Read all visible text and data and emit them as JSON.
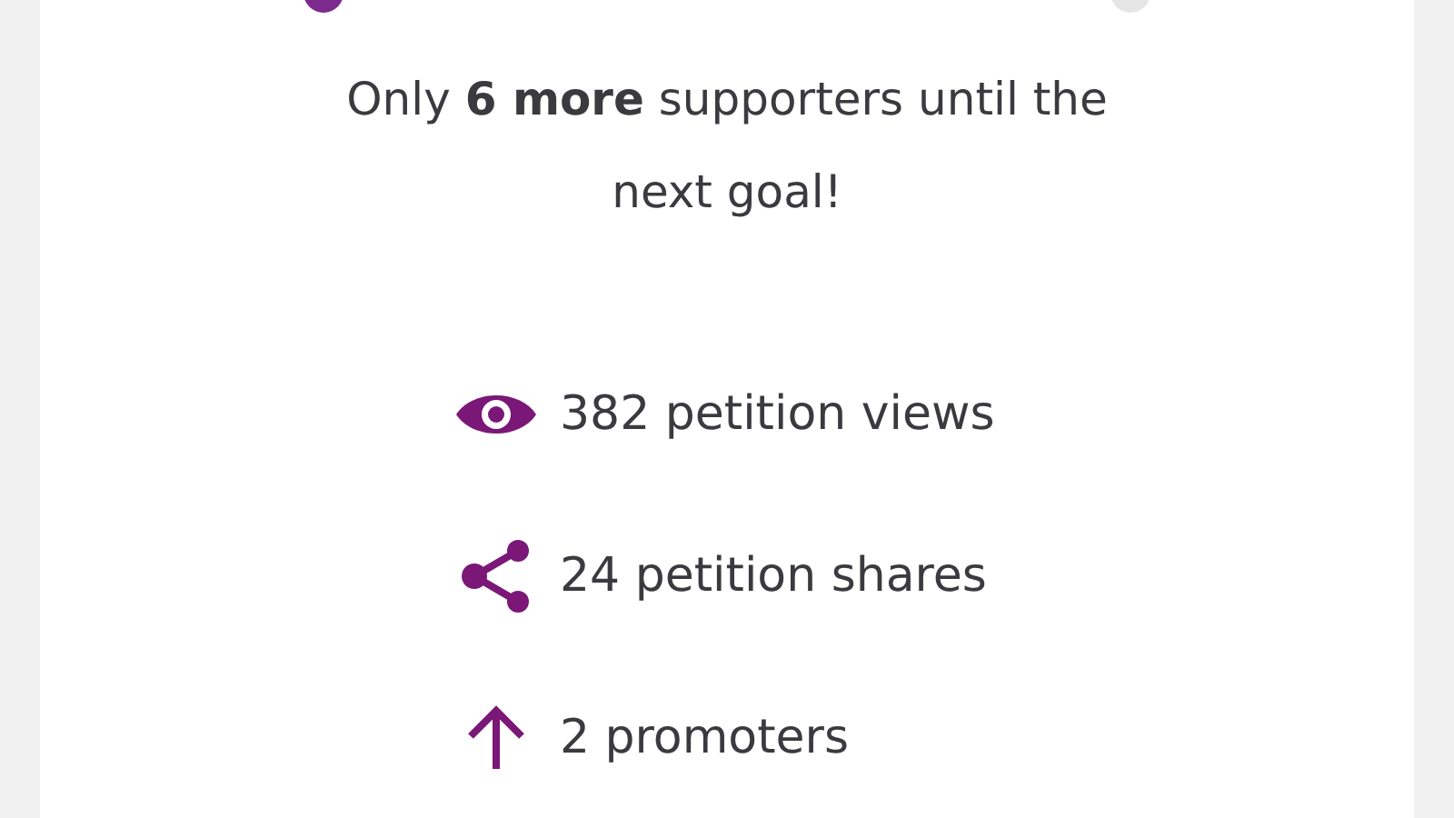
{
  "milestones": [
    {
      "reached": true
    },
    {
      "reached": false
    }
  ],
  "message": "Only **6 more** supporters until the next goal!",
  "stats": [
    {
      "kind": "views",
      "text": "382 petition views"
    },
    {
      "kind": "shares",
      "text": "24 petition shares"
    },
    {
      "kind": "promoters",
      "text": "2 promoters"
    }
  ]
}
